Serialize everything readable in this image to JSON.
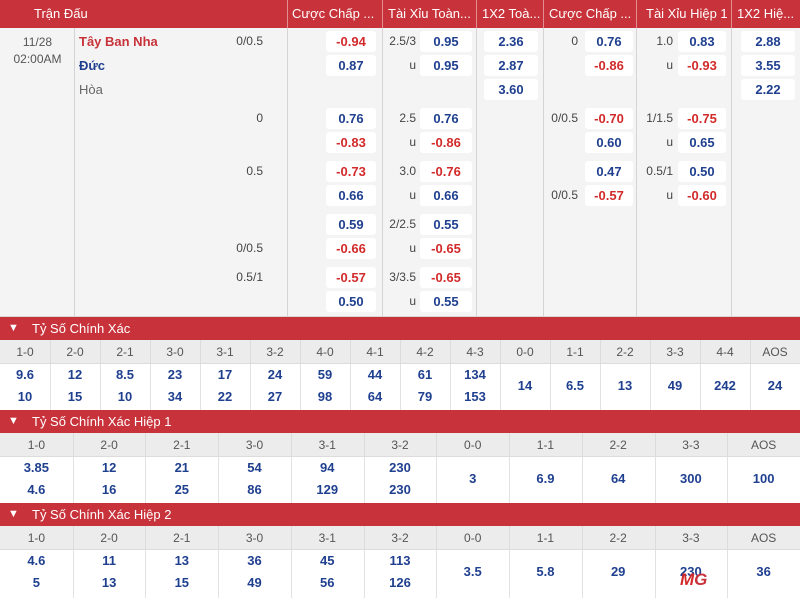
{
  "header": {
    "match_col": "Trận Đấu",
    "handicap_ft": "Cược Chấp ...",
    "ou_ft": "Tài Xỉu Toàn...",
    "x12_ft": "1X2 Toà...",
    "handicap_h1": "Cược Chấp ...",
    "ou_h1": "Tài Xỉu Hiệp 1",
    "x12_h1": "1X2 Hiệ..."
  },
  "match": {
    "date": "11/28",
    "time": "02:00AM",
    "home": "Tây Ban Nha",
    "away": "Đức",
    "draw": "Hòa"
  },
  "odds": {
    "hdp_ft": [
      {
        "line": "0/0.5",
        "v": "-0.94"
      },
      {
        "line": "",
        "v": "0.87"
      },
      {
        "line": "0",
        "v": "0.76"
      },
      {
        "line": "",
        "v": "-0.83"
      },
      {
        "line": "0.5",
        "v": "-0.73"
      },
      {
        "line": "",
        "v": "0.66"
      },
      {
        "line": "",
        "v": "0.59"
      },
      {
        "line": "0/0.5",
        "v": "-0.66"
      },
      {
        "line": "0.5/1",
        "v": "-0.57"
      },
      {
        "line": "",
        "v": "0.50"
      }
    ],
    "ou_ft": [
      {
        "line": "2.5/3",
        "v": "0.95"
      },
      {
        "line": "u",
        "v": "0.95"
      },
      {
        "line": "2.5",
        "v": "0.76"
      },
      {
        "line": "u",
        "v": "-0.86"
      },
      {
        "line": "3.0",
        "v": "-0.76"
      },
      {
        "line": "u",
        "v": "0.66"
      },
      {
        "line": "2/2.5",
        "v": "0.55"
      },
      {
        "line": "u",
        "v": "-0.65"
      },
      {
        "line": "3/3.5",
        "v": "-0.65"
      },
      {
        "line": "u",
        "v": "0.55"
      }
    ],
    "x12_ft": [
      "2.36",
      "2.87",
      "3.60"
    ],
    "hdp_h1": [
      {
        "line": "0",
        "v": "0.76"
      },
      {
        "line": "",
        "v": "-0.86"
      },
      {
        "line": "0/0.5",
        "v": "-0.70"
      },
      {
        "line": "",
        "v": "0.60"
      },
      {
        "line": "",
        "v": "0.47"
      },
      {
        "line": "0/0.5",
        "v": "-0.57"
      }
    ],
    "ou_h1": [
      {
        "line": "1.0",
        "v": "0.83"
      },
      {
        "line": "u",
        "v": "-0.93"
      },
      {
        "line": "1/1.5",
        "v": "-0.75"
      },
      {
        "line": "u",
        "v": "0.65"
      },
      {
        "line": "0.5/1",
        "v": "0.50"
      },
      {
        "line": "u",
        "v": "-0.60"
      }
    ],
    "x12_h1": [
      "2.88",
      "3.55",
      "2.22"
    ]
  },
  "correct_score": {
    "title": "Tỷ Số Chính Xác",
    "headers": [
      "1-0",
      "2-0",
      "2-1",
      "3-0",
      "3-1",
      "3-2",
      "4-0",
      "4-1",
      "4-2",
      "4-3",
      "0-0",
      "1-1",
      "2-2",
      "3-3",
      "4-4",
      "AOS"
    ],
    "row1": [
      "9.6",
      "12",
      "8.5",
      "23",
      "17",
      "24",
      "59",
      "44",
      "61",
      "134"
    ],
    "row2": [
      "10",
      "15",
      "10",
      "34",
      "22",
      "27",
      "98",
      "64",
      "79",
      "153"
    ],
    "draws": [
      "14",
      "6.5",
      "13",
      "49",
      "242",
      "24"
    ]
  },
  "correct_score_h1": {
    "title": "Tỷ Số Chính Xác Hiệp 1",
    "headers": [
      "1-0",
      "2-0",
      "2-1",
      "3-0",
      "3-1",
      "3-2",
      "0-0",
      "1-1",
      "2-2",
      "3-3",
      "AOS"
    ],
    "row1": [
      "3.85",
      "12",
      "21",
      "54",
      "94",
      "230"
    ],
    "row2": [
      "4.6",
      "16",
      "25",
      "86",
      "129",
      "230"
    ],
    "draws": [
      "3",
      "6.9",
      "64",
      "300",
      "100"
    ]
  },
  "correct_score_h2": {
    "title": "Tỷ Số Chính Xác Hiệp 2",
    "headers": [
      "1-0",
      "2-0",
      "2-1",
      "3-0",
      "3-1",
      "3-2",
      "0-0",
      "1-1",
      "2-2",
      "3-3",
      "AOS"
    ],
    "row1": [
      "4.6",
      "11",
      "13",
      "36",
      "45",
      "113"
    ],
    "row2": [
      "5",
      "13",
      "15",
      "49",
      "56",
      "126"
    ],
    "draws": [
      "3.5",
      "5.8",
      "29",
      "230",
      "36"
    ]
  },
  "logo": {
    "text_m": "M",
    "text_g": "G"
  },
  "colors": {
    "accent": "#c8323a",
    "positive": "#1f3f8f",
    "negative": "#d22a2a"
  }
}
